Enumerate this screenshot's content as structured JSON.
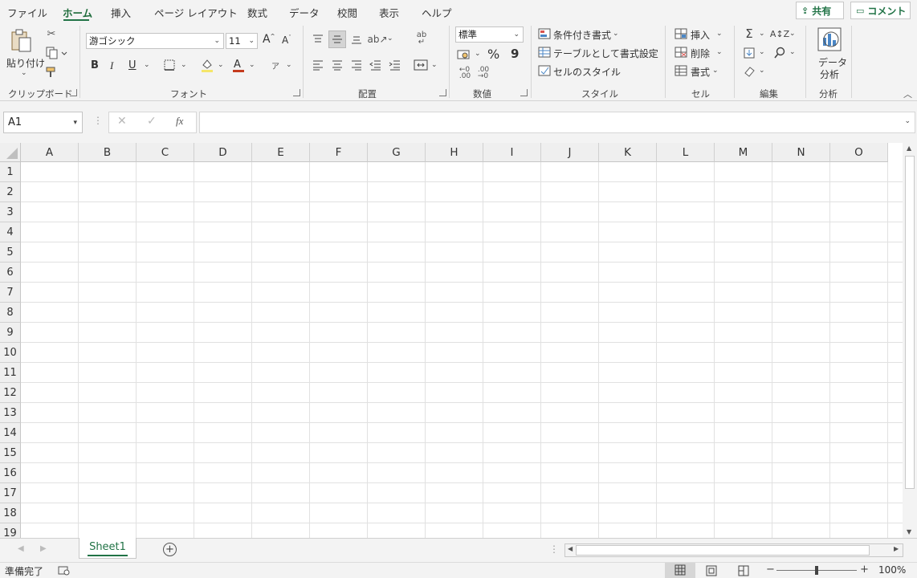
{
  "tabs": [
    "ファイル",
    "ホーム",
    "挿入",
    "ページ レイアウト",
    "数式",
    "データ",
    "校閲",
    "表示",
    "ヘルプ"
  ],
  "share_label": "共有",
  "comment_label": "コメント",
  "clipboard": {
    "paste_label": "貼り付け",
    "group_label": "クリップボード"
  },
  "font": {
    "name": "游ゴシック",
    "size": "11",
    "bold": "B",
    "italic": "I",
    "underline": "U",
    "group_label": "フォント"
  },
  "alignment": {
    "group_label": "配置"
  },
  "number": {
    "format": "標準",
    "percent": "%",
    "comma": "9",
    "group_label": "数値"
  },
  "styles": {
    "conditional": "条件付き書式",
    "table": "テーブルとして書式設定",
    "cell_styles": "セルのスタイル",
    "group_label": "スタイル"
  },
  "cells": {
    "insert": "挿入",
    "delete": "削除",
    "format": "書式",
    "group_label": "セル"
  },
  "editing": {
    "group_label": "編集"
  },
  "analysis": {
    "button_line1": "データ",
    "button_line2": "分析",
    "group_label": "分析"
  },
  "formula": {
    "name_box": "A1",
    "fx": "fx",
    "value": ""
  },
  "columns": [
    "A",
    "B",
    "C",
    "D",
    "E",
    "F",
    "G",
    "H",
    "I",
    "J",
    "K",
    "L",
    "M",
    "N",
    "O"
  ],
  "rows": [
    "1",
    "2",
    "3",
    "4",
    "5",
    "6",
    "7",
    "8",
    "9",
    "10",
    "11",
    "12",
    "13",
    "14",
    "15",
    "16",
    "17",
    "18",
    "19"
  ],
  "sheet": {
    "name": "Sheet1"
  },
  "status": {
    "ready": "準備完了",
    "zoom": "100%"
  },
  "colors": {
    "accent": "#217346",
    "grid": "#e1e1e1"
  }
}
